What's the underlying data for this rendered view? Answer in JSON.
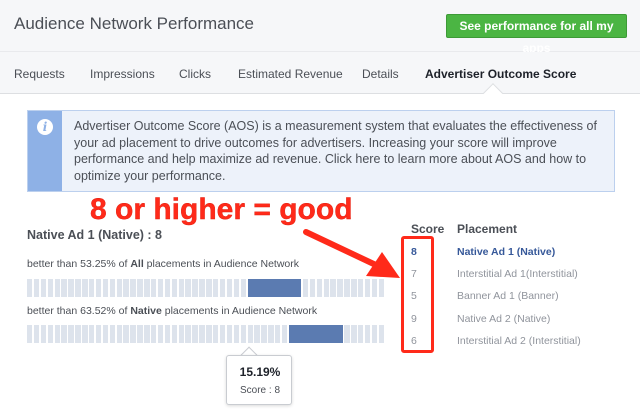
{
  "header": {
    "title": "Audience Network Performance",
    "cta_label": "See performance for all my apps"
  },
  "tabs": [
    {
      "label": "Requests",
      "active": false
    },
    {
      "label": "Impressions",
      "active": false
    },
    {
      "label": "Clicks",
      "active": false
    },
    {
      "label": "Estimated Revenue",
      "active": false
    },
    {
      "label": "Details",
      "active": false
    },
    {
      "label": "Advertiser Outcome Score",
      "active": true
    }
  ],
  "info": {
    "icon": "info-icon",
    "text": "Advertiser Outcome Score (AOS) is a measurement system that evaluates the effectiveness of your ad placement to drive outcomes for advertisers. Increasing your score will improve performance and help maximize ad revenue. Click here to learn more about AOS and how to optimize your performance."
  },
  "annotation": {
    "text": "8 or higher = good",
    "color": "#ff2a1a"
  },
  "selected_ad": {
    "title": "Native Ad 1 (Native) : 8",
    "comparisons": [
      {
        "prefix": "better than 53.25% of ",
        "bold": "All",
        "suffix": " placements in Audience Network"
      },
      {
        "prefix": "better than 63.52% of ",
        "bold": "Native",
        "suffix": " placements in Audience Network"
      }
    ],
    "tooltip": {
      "percent": "15.19%",
      "score": "Score : 8"
    }
  },
  "table": {
    "score_header": "Score",
    "placement_header": "Placement",
    "rows": [
      {
        "score": "8",
        "placement": "Native Ad 1 (Native)",
        "selected": true
      },
      {
        "score": "7",
        "placement": "Interstitial Ad 1(Interstitial)",
        "selected": false
      },
      {
        "score": "5",
        "placement": "Banner Ad 1 (Banner)",
        "selected": false
      },
      {
        "score": "9",
        "placement": "Native Ad 2 (Native)",
        "selected": false
      },
      {
        "score": "6",
        "placement": "Interstitial Ad 2 (Interstitial)",
        "selected": false
      }
    ]
  },
  "colors": {
    "accent": "#4bb543",
    "link": "#365899",
    "highlight_bar": "#5b7bb1",
    "annotation": "#ff2a1a"
  }
}
